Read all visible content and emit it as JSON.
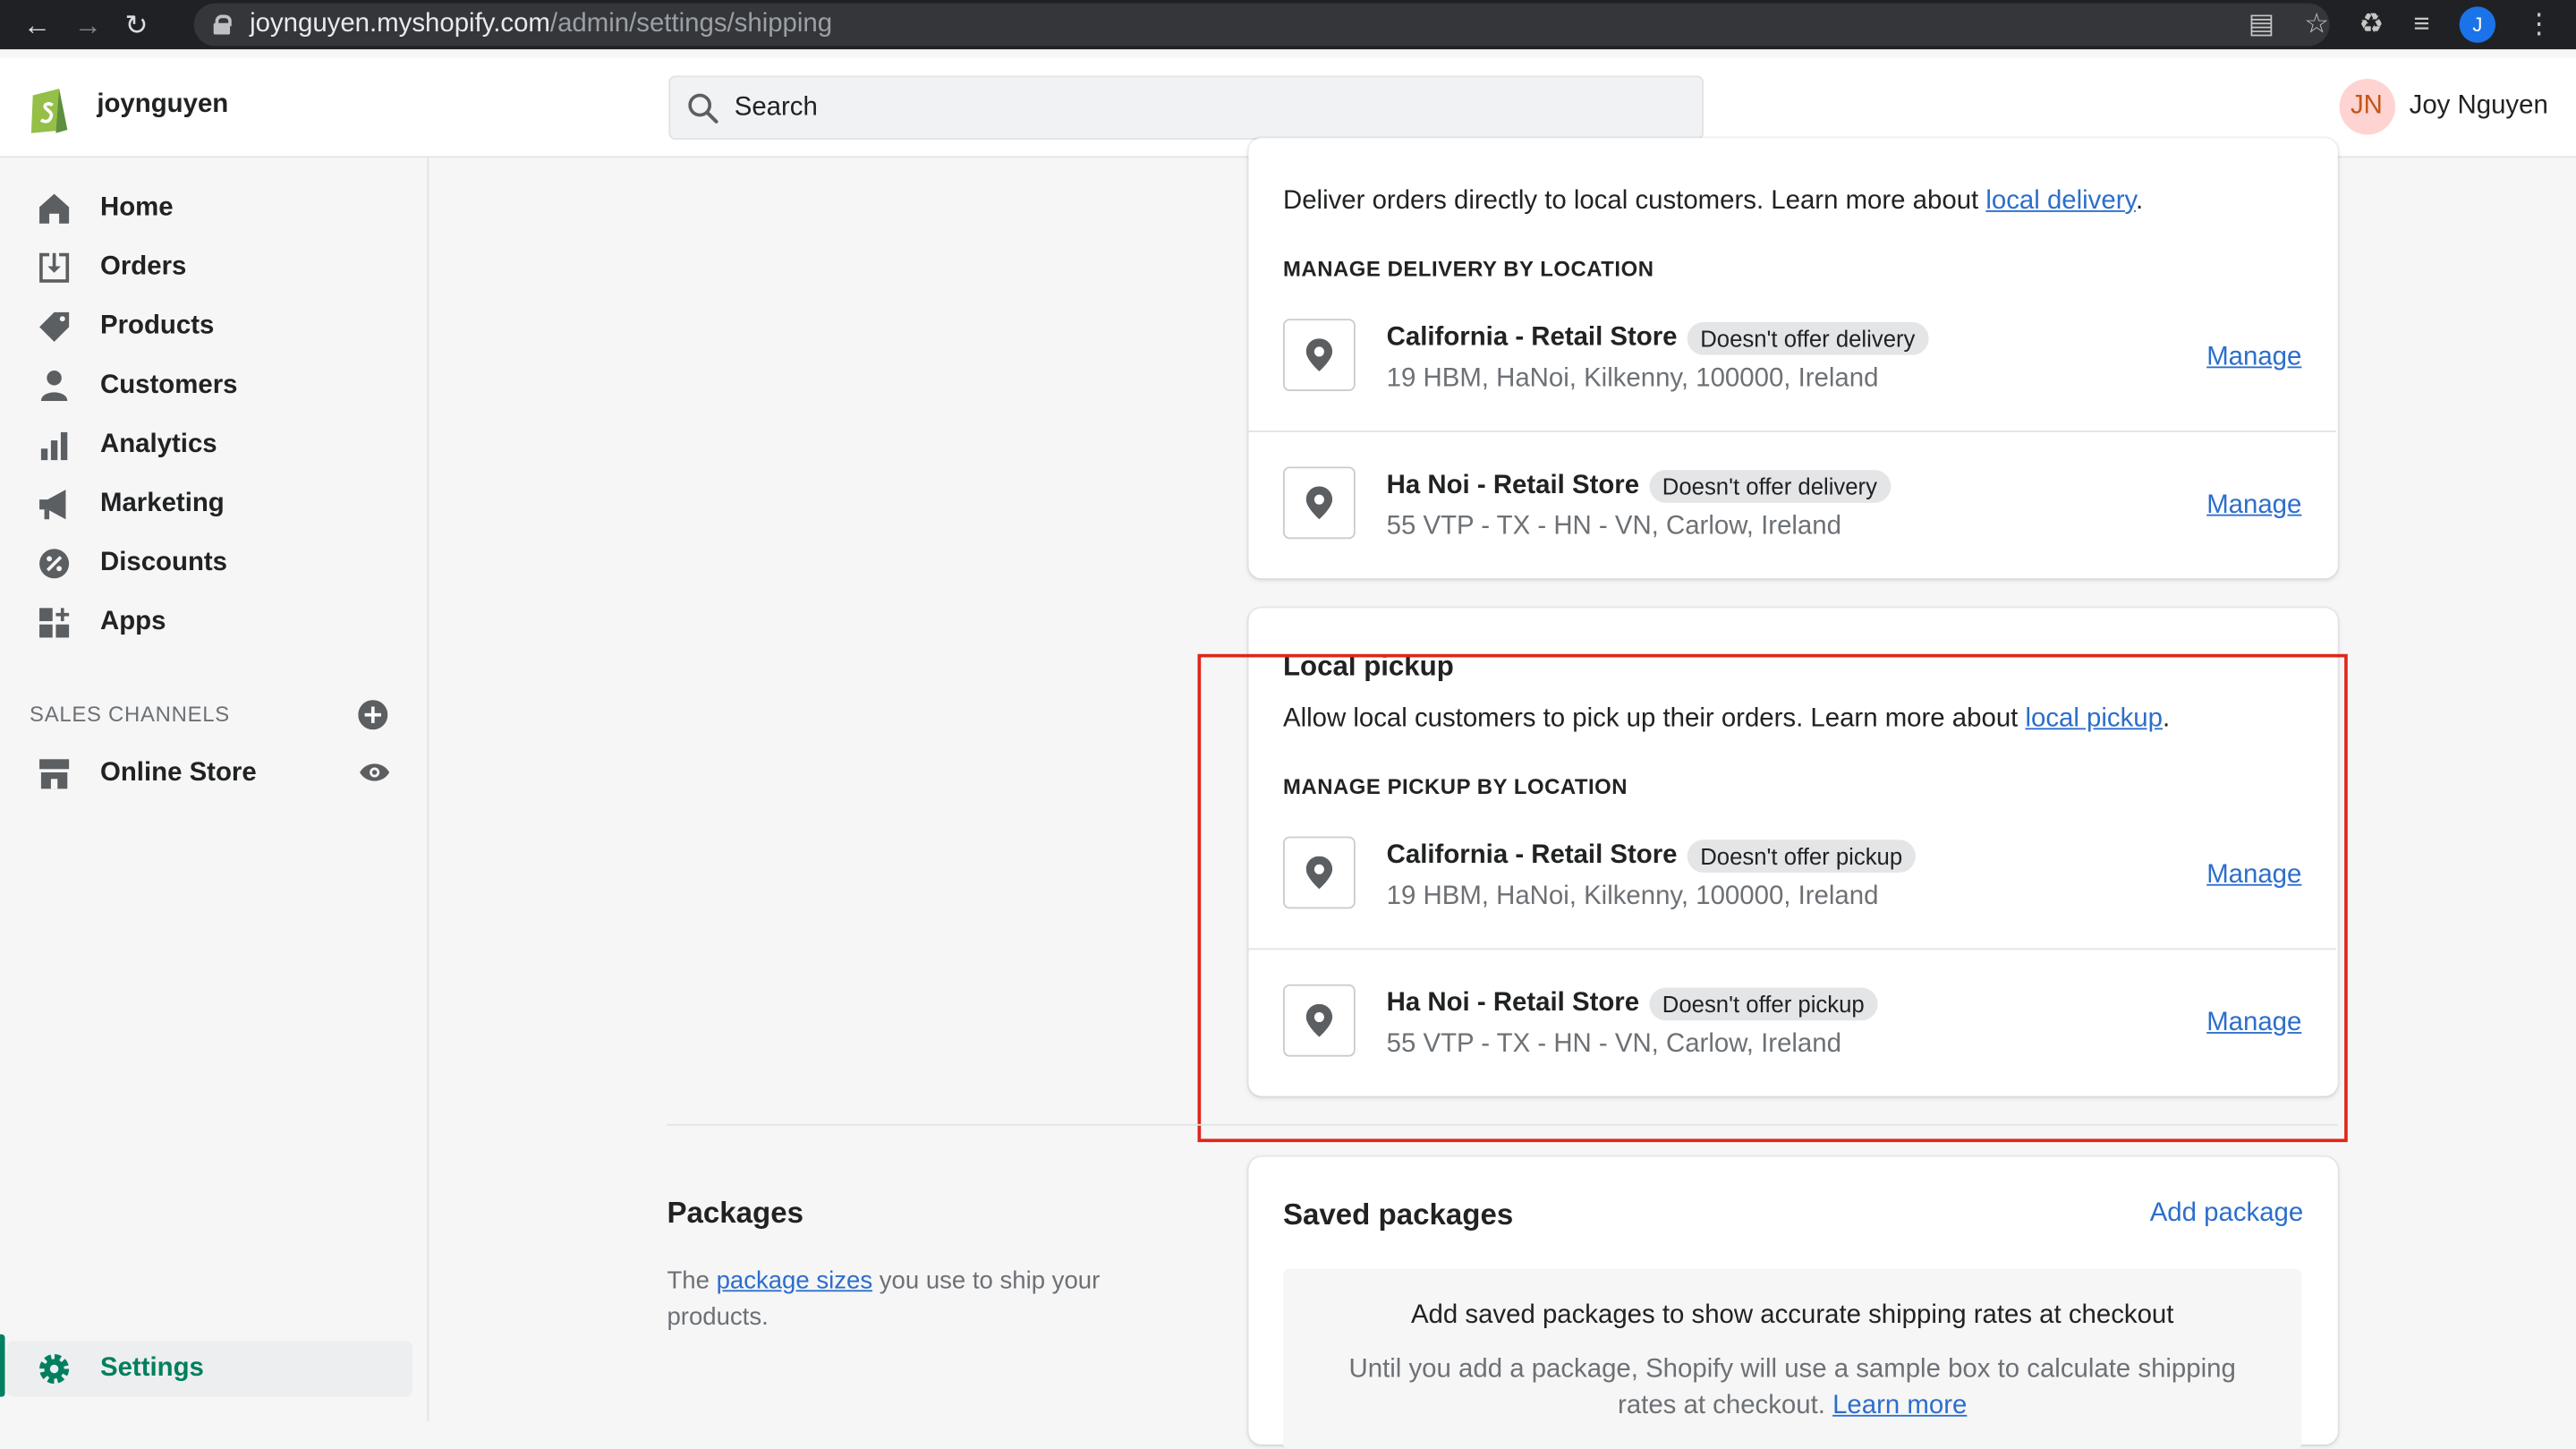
{
  "browser": {
    "url_host": "joynguyen.myshopify.com",
    "url_path": "/admin/settings/shipping",
    "profile_initial": "J"
  },
  "topbar": {
    "store_name": "joynguyen",
    "search_placeholder": "Search",
    "user_initials": "JN",
    "user_name": "Joy Nguyen"
  },
  "sidebar": {
    "items": [
      {
        "label": "Home",
        "icon": "home-icon"
      },
      {
        "label": "Orders",
        "icon": "orders-icon"
      },
      {
        "label": "Products",
        "icon": "tag-icon"
      },
      {
        "label": "Customers",
        "icon": "person-icon"
      },
      {
        "label": "Analytics",
        "icon": "bar-chart-icon"
      },
      {
        "label": "Marketing",
        "icon": "megaphone-icon"
      },
      {
        "label": "Discounts",
        "icon": "discount-icon"
      },
      {
        "label": "Apps",
        "icon": "apps-icon"
      }
    ],
    "sales_channels_heading": "SALES CHANNELS",
    "online_store": "Online Store",
    "settings": "Settings"
  },
  "local_delivery": {
    "description": "Deliver orders directly to local customers. Learn more about ",
    "link": "local delivery",
    "section_label": "MANAGE DELIVERY BY LOCATION",
    "locations": [
      {
        "name": "California - Retail Store",
        "badge": "Doesn't offer delivery",
        "address": "19 HBM, HaNoi, Kilkenny, 100000, Ireland",
        "action": "Manage"
      },
      {
        "name": "Ha Noi - Retail Store",
        "badge": "Doesn't offer delivery",
        "address": "55 VTP - TX - HN - VN, Carlow, Ireland",
        "action": "Manage"
      }
    ]
  },
  "local_pickup": {
    "title": "Local pickup",
    "description": "Allow local customers to pick up their orders. Learn more about ",
    "link": "local pickup",
    "section_label": "MANAGE PICKUP BY LOCATION",
    "locations": [
      {
        "name": "California - Retail Store",
        "badge": "Doesn't offer pickup",
        "address": "19 HBM, HaNoi, Kilkenny, 100000, Ireland",
        "action": "Manage"
      },
      {
        "name": "Ha Noi - Retail Store",
        "badge": "Doesn't offer pickup",
        "address": "55 VTP - TX - HN - VN, Carlow, Ireland",
        "action": "Manage"
      }
    ]
  },
  "packages": {
    "heading": "Packages",
    "desc_prefix": "The ",
    "desc_link": "package sizes",
    "desc_suffix": " you use to ship your products.",
    "card_title": "Saved packages",
    "add_action": "Add package",
    "empty_title": "Add saved packages to show accurate shipping rates at checkout",
    "empty_body": "Until you add a package, Shopify will use a sample box to calculate shipping rates at checkout. ",
    "learn_more": "Learn more"
  },
  "colors": {
    "accent_link": "#2c6ecb",
    "brand_green": "#008060",
    "highlight_red": "#e0261a"
  }
}
